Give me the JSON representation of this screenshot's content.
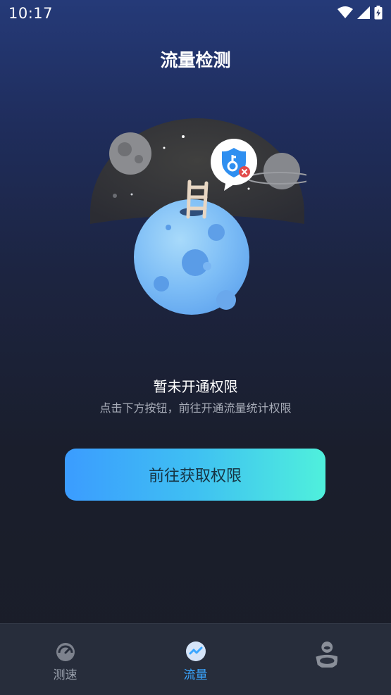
{
  "status_bar": {
    "time": "10:17"
  },
  "header": {
    "title": "流量检测"
  },
  "message": {
    "title": "暂未开通权限",
    "subtitle": "点击下方按钮，前往开通流量统计权限"
  },
  "cta": {
    "label": "前往获取权限"
  },
  "tabs": [
    {
      "label": "测速",
      "icon": "speedometer-icon",
      "active": false
    },
    {
      "label": "流量",
      "icon": "traffic-chart-icon",
      "active": true
    },
    {
      "label": "",
      "icon": "profile-icon",
      "active": false
    }
  ],
  "colors": {
    "accent_tab": "#3aa6ff",
    "inactive_tab": "#9aa1ad",
    "button_start": "#3b9cff",
    "button_end": "#4ff0dc"
  }
}
